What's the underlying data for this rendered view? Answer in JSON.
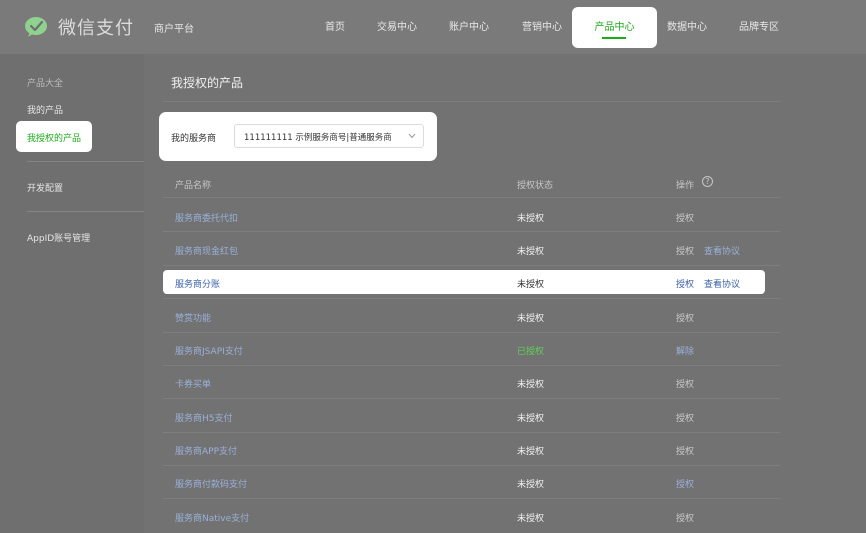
{
  "header": {
    "logo_text": "微信支付",
    "platform": "商户平台",
    "nav": [
      "首页",
      "交易中心",
      "账户中心",
      "营销中心",
      "产品中心",
      "数据中心",
      "品牌专区"
    ],
    "active_nav": "产品中心"
  },
  "sidebar": {
    "section_label": "产品大全",
    "items": [
      "我的产品",
      "我授权的产品",
      "开发配置",
      "AppID账号管理"
    ],
    "active": "我授权的产品"
  },
  "main": {
    "title": "我授权的产品",
    "selector": {
      "label": "我的服务商",
      "value": "111111111  示例服务商号|普通服务商"
    },
    "table": {
      "headers": [
        "产品名称",
        "授权状态",
        "操作"
      ],
      "rows": [
        {
          "name": "服务商委托代扣",
          "status": "未授权",
          "op": "授权",
          "agree": ""
        },
        {
          "name": "服务商现金红包",
          "status": "未授权",
          "op": "授权",
          "agree": "查看协议"
        },
        {
          "name": "服务商分账",
          "status": "未授权",
          "op": "授权",
          "agree": "查看协议"
        },
        {
          "name": "赞赏功能",
          "status": "未授权",
          "op": "授权",
          "agree": ""
        },
        {
          "name": "服务商JSAPI支付",
          "status": "已授权",
          "op": "解除",
          "agree": ""
        },
        {
          "name": "卡券买单",
          "status": "未授权",
          "op": "授权",
          "agree": ""
        },
        {
          "name": "服务商H5支付",
          "status": "未授权",
          "op": "授权",
          "agree": ""
        },
        {
          "name": "服务商APP支付",
          "status": "未授权",
          "op": "授权",
          "agree": ""
        },
        {
          "name": "服务商付款码支付",
          "status": "未授权",
          "op": "授权",
          "agree": ""
        },
        {
          "name": "服务商Native支付",
          "status": "未授权",
          "op": "授权",
          "agree": ""
        }
      ]
    }
  },
  "colors": {
    "brand_green": "#1aad19",
    "link_blue": "#3a5fa8",
    "overlay_gray": "#727272"
  }
}
